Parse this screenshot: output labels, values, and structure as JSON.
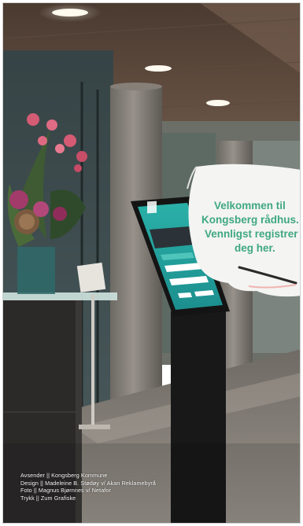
{
  "sign": {
    "line1": "Velkommen til",
    "line2": "Kongsberg rådhus.",
    "line3": "Vennligst registrer",
    "line4": "deg her."
  },
  "credits": [
    "Avsender || Kongsberg Kommune",
    "Design || Madeleine B. Stødøy v/ Akan Reklamebyrå",
    "Foto || Magnus Bjørnnes v/ Netafor",
    "Trykk || Zum Grafiske"
  ],
  "colors": {
    "brand_green": "#3ea784",
    "kiosk_screen": "#2aa6a3"
  }
}
